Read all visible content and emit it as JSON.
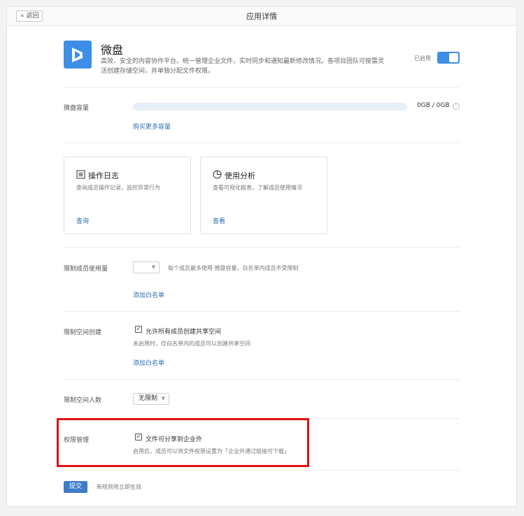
{
  "header": {
    "back_label": "« 返回",
    "title": "应用详情"
  },
  "app": {
    "name": "微盘",
    "description": "高效、安全的内容协作平台。统一管理企业文件，实时同步和通知最新修改情况。各项目团队可按需灵活创建存储空间，并单独分配文件权限。",
    "enabled_label": "已启用",
    "enabled": true,
    "logo_icon": "weipan-logo-icon",
    "accent_color": "#3d8ee6"
  },
  "capacity": {
    "label": "微盘容量",
    "usage_text": "0GB / 0GB",
    "used_fraction": 0,
    "buy_more_label": "购买更多容量",
    "info_icon": "info-icon"
  },
  "cards": [
    {
      "icon": "log-icon",
      "title": "操作日志",
      "desc": "查询成员操作记录，监控异常行为",
      "link": "查询"
    },
    {
      "icon": "pie-chart-icon",
      "title": "使用分析",
      "desc": "查看可视化报表，了解成员使用情况",
      "link": "查看"
    }
  ],
  "member_limit": {
    "label": "限制成员使用量",
    "select_value": "",
    "hint": "每个成员最多使用 微盘容量，白名单内成员不受限制",
    "whitelist_label": "添加白名单"
  },
  "space_create": {
    "label": "限制空间创建",
    "checkbox_label": "允许所有成员创建共享空间",
    "checked": true,
    "hint": "未启用时，仅白名单内的成员可以创建共享空间",
    "whitelist_label": "添加白名单"
  },
  "space_members": {
    "label": "限制空间人数",
    "select_value": "无限制"
  },
  "permission": {
    "label": "权限管理",
    "checkbox_label": "文件可分享到企业外",
    "checked": true,
    "hint": "启用后，成员可以将文件权限设置为「企业外通过链接可下载」",
    "highlight_color": "#e01010"
  },
  "footer": {
    "submit_label": "提交",
    "hint": "新规则将立即生效"
  }
}
